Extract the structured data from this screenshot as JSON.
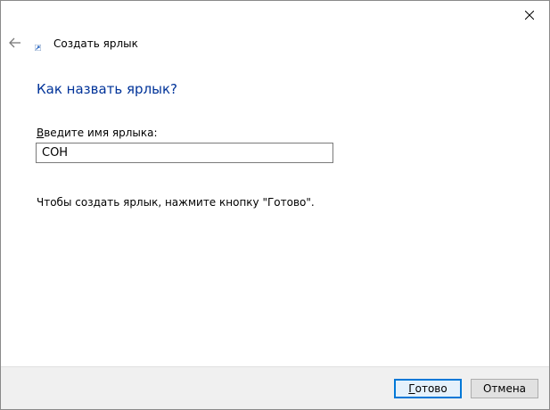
{
  "window": {
    "close_label": "Close"
  },
  "header": {
    "title": "Создать ярлык",
    "back_icon": "back-arrow-icon",
    "wizard_icon": "shortcut-icon"
  },
  "main": {
    "heading": "Как назвать ярлык?",
    "field_label_accel": "В",
    "field_label_rest": "ведите имя ярлыка:",
    "input_value": "СОН",
    "instruction": "Чтобы создать ярлык, нажмите кнопку \"Готово\"."
  },
  "footer": {
    "ok_accel": "Г",
    "ok_rest": "отово",
    "cancel_label": "Отмена"
  },
  "colors": {
    "heading": "#003399",
    "accent_border": "#0078d7",
    "footer_bg": "#f0f0f0"
  }
}
